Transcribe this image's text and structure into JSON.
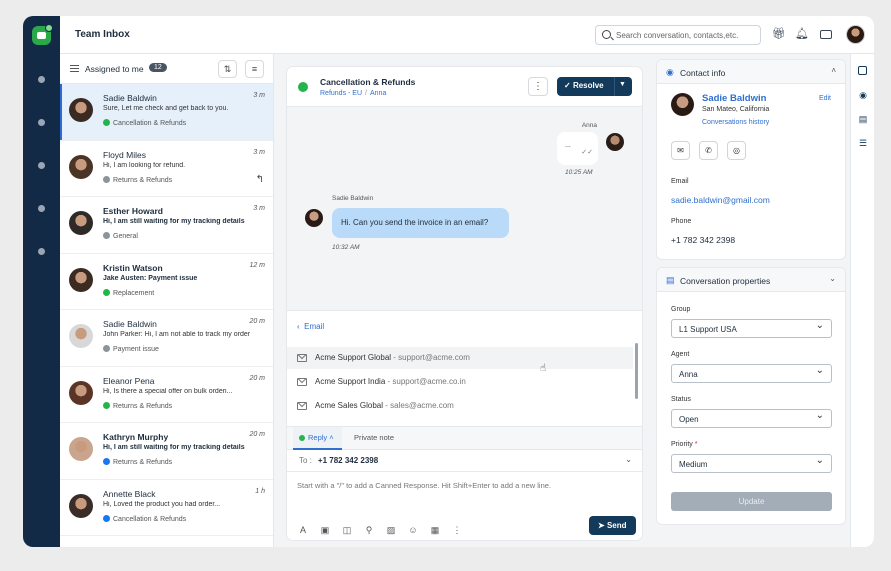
{
  "topbar": {
    "title": "Team Inbox",
    "search_placeholder": "Search conversation, contacts,etc."
  },
  "list": {
    "header_label": "Assigned to me",
    "count": "12",
    "items": [
      {
        "name": "Sadie Baldwin",
        "time": "3 m",
        "message": "Sure, Let me check and get back to you.",
        "tag": "Cancellation & Refunds",
        "channel": "whatsapp",
        "unread": false
      },
      {
        "name": "Floyd Miles",
        "time": "3 m",
        "message": "Hi, I am looking for refund.",
        "tag": "Returns & Refunds",
        "channel": "web",
        "unread": false
      },
      {
        "name": "Esther Howard",
        "time": "3 m",
        "message": "Hi, I am still waiting for my tracking details",
        "tag": "General",
        "channel": "web",
        "unread": true
      },
      {
        "name": "Kristin Watson",
        "time": "12 m",
        "message": "Jake Austen: Payment issue",
        "tag": "Replacement",
        "channel": "whatsapp",
        "unread": true
      },
      {
        "name": "Sadie Baldwin",
        "time": "20 m",
        "message": "John Parker: Hi, I am not able to track my order",
        "tag": "Payment issue",
        "channel": "web",
        "unread": false
      },
      {
        "name": "Eleanor Pena",
        "time": "20 m",
        "message": "Hi, Is there a special offer on bulk orderi...",
        "tag": "Returns & Refunds",
        "channel": "whatsapp",
        "unread": false
      },
      {
        "name": "Kathryn Murphy",
        "time": "20 m",
        "message": "Hi, I am still waiting for my tracking details",
        "tag": "Returns & Refunds",
        "channel": "facebook",
        "unread": true
      },
      {
        "name": "Annette Black",
        "time": "1 h",
        "message": "Hi, Loved the product you had order...",
        "tag": "Cancellation & Refunds",
        "channel": "facebook",
        "unread": false
      }
    ]
  },
  "conversation": {
    "title": "Cancellation & Refunds",
    "crumb_1": "Refunds - EU",
    "crumb_sep": "/",
    "crumb_2": "Anna",
    "resolve_label": "Resolve",
    "agent_name": "Anna",
    "outgoing_text": "...",
    "outgoing_time": "10:25 AM",
    "customer_name": "Sadie Baldwin",
    "incoming_text": "Hi. Can you send the invoice in an email?",
    "incoming_time": "10:32 AM"
  },
  "email_picker": {
    "header": "Email",
    "options": [
      {
        "name": "Acme Support Global",
        "address": "- support@acme.com"
      },
      {
        "name": "Acme Support India",
        "address": "- support@acme.co.in"
      },
      {
        "name": "Acme Sales Global",
        "address": "- sales@acme.com"
      }
    ]
  },
  "compose": {
    "tab_reply": "Reply",
    "tab_note": "Private note",
    "to_label": "To :",
    "to_value": "+1 782 342 2398",
    "placeholder": "Start with a \"/\" to add a Canned Response. Hit Shift+Enter to add a new line.",
    "send_label": "Send"
  },
  "contact": {
    "header": "Contact info",
    "name": "Sadie Baldwin",
    "location": "San Mateo, California",
    "edit_label": "Edit",
    "history_label": "Conversations history",
    "email_label": "Email",
    "email": "sadie.baldwin@gmail.com",
    "phone_label": "Phone",
    "phone": "+1 782 342 2398"
  },
  "properties": {
    "header": "Conversation properties",
    "group_label": "Group",
    "group": "L1 Support USA",
    "agent_label": "Agent",
    "agent": "Anna",
    "status_label": "Status",
    "status": "Open",
    "priority_label": "Priority",
    "priority_required": "*",
    "priority": "Medium",
    "update_label": "Update"
  },
  "colors": {
    "rail": "#132a47",
    "accent": "#2f6fce",
    "primary_button": "#13395b",
    "whatsapp": "#25b44c",
    "facebook": "#1877f2",
    "incoming_bubble": "#b9daf8"
  }
}
